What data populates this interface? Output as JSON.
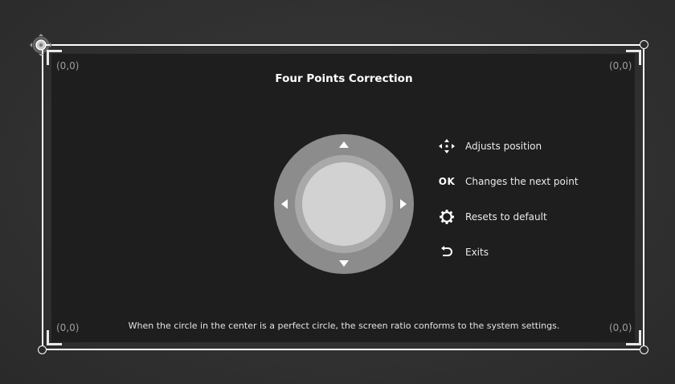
{
  "header": {
    "title": "Four Points Correction"
  },
  "corners": {
    "top_left": "(0,0)",
    "top_right": "(0,0)",
    "bottom_left": "(0,0)",
    "bottom_right": "(0,0)"
  },
  "legend": {
    "items": [
      {
        "icon": "move-arrows-icon",
        "label": "Adjusts position"
      },
      {
        "icon": "ok-key",
        "key_label": "OK",
        "label": "Changes the next point"
      },
      {
        "icon": "gear-icon",
        "label": "Resets to default"
      },
      {
        "icon": "back-arrow-icon",
        "label": "Exits"
      }
    ]
  },
  "footer": {
    "note": "When the circle in the center is a perfect circle, the screen ratio conforms to the system settings."
  },
  "colors": {
    "background": "#2c2c2c",
    "screen": "#1e1e1e",
    "frame": "#ffffff",
    "dpad_outer": "#8c8c8c",
    "dpad_ring": "#a8a8a8",
    "dpad_center": "#d0d0d0"
  }
}
